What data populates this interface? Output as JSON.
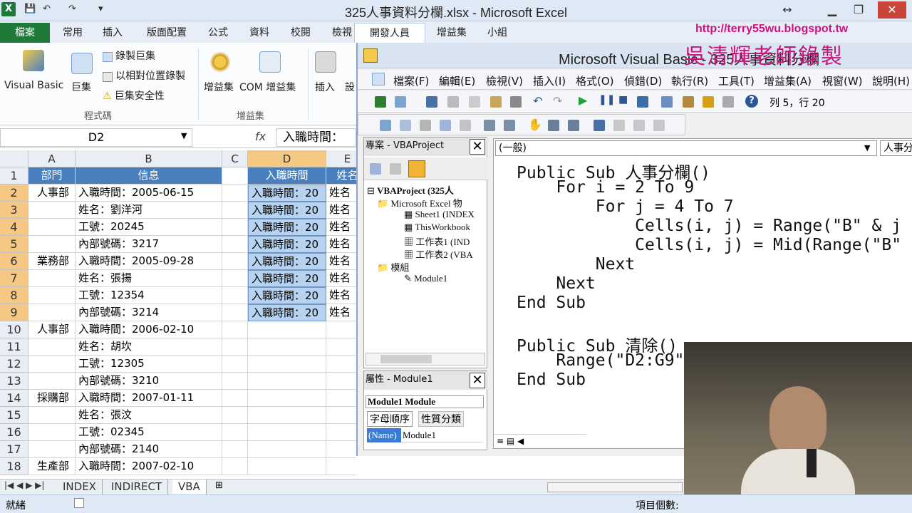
{
  "window": {
    "title": "325人事資料分欄.xlsx - Microsoft Excel",
    "qat": [
      "↶",
      "↷"
    ]
  },
  "ribbon": {
    "tabs": [
      "檔案",
      "常用",
      "插入",
      "版面配置",
      "公式",
      "資料",
      "校閱",
      "檢視",
      "開發人員",
      "增益集",
      "小組"
    ],
    "code_group": {
      "label": "程式碼",
      "visual_basic": "Visual Basic",
      "macros": "巨集",
      "record_macro": "錄製巨集",
      "relative_ref": "以相對位置錄製",
      "macro_security": "巨集安全性"
    },
    "addins_group": {
      "label": "增益集",
      "addins": "增益集",
      "com_addins": "COM 增益集"
    },
    "controls_group": {
      "insert": "插入",
      "design": "設"
    }
  },
  "formula_bar": {
    "name_box": "D2",
    "fx": "fx",
    "value": "入職時間："
  },
  "sheet": {
    "columns": [
      "A",
      "B",
      "C",
      "D",
      "E"
    ],
    "rows": [
      {
        "n": "1",
        "a": "部門",
        "b": "信息",
        "d": "入職時間",
        "e": "姓名"
      },
      {
        "n": "2",
        "a": "人事部",
        "b": "入職時間：2005-06-15",
        "d": "入職時間：20",
        "e": "姓名"
      },
      {
        "n": "3",
        "a": "",
        "b": "姓名：劉洋河",
        "d": "入職時間：20",
        "e": "姓名"
      },
      {
        "n": "4",
        "a": "",
        "b": "工號：20245",
        "d": "入職時間：20",
        "e": "姓名"
      },
      {
        "n": "5",
        "a": "",
        "b": "內部號碼：3217",
        "d": "入職時間：20",
        "e": "姓名"
      },
      {
        "n": "6",
        "a": "業務部",
        "b": "入職時間：2005-09-28",
        "d": "入職時間：20",
        "e": "姓名"
      },
      {
        "n": "7",
        "a": "",
        "b": "姓名：張揚",
        "d": "入職時間：20",
        "e": "姓名"
      },
      {
        "n": "8",
        "a": "",
        "b": "工號：12354",
        "d": "入職時間：20",
        "e": "姓名"
      },
      {
        "n": "9",
        "a": "",
        "b": "內部號碼：3214",
        "d": "入職時間：20",
        "e": "姓名"
      },
      {
        "n": "10",
        "a": "人事部",
        "b": "入職時間：2006-02-10",
        "d": "",
        "e": ""
      },
      {
        "n": "11",
        "a": "",
        "b": "姓名：胡坎",
        "d": "",
        "e": ""
      },
      {
        "n": "12",
        "a": "",
        "b": "工號：12305",
        "d": "",
        "e": ""
      },
      {
        "n": "13",
        "a": "",
        "b": "內部號碼：3210",
        "d": "",
        "e": ""
      },
      {
        "n": "14",
        "a": "採購部",
        "b": "入職時間：2007-01-11",
        "d": "",
        "e": ""
      },
      {
        "n": "15",
        "a": "",
        "b": "姓名：張汶",
        "d": "",
        "e": ""
      },
      {
        "n": "16",
        "a": "",
        "b": "工號：02345",
        "d": "",
        "e": ""
      },
      {
        "n": "17",
        "a": "",
        "b": "內部號碼：2140",
        "d": "",
        "e": ""
      },
      {
        "n": "18",
        "a": "生產部",
        "b": "入職時間：2007-02-10",
        "d": "",
        "e": ""
      }
    ],
    "sheet_tabs": [
      "INDEX",
      "INDIRECT",
      "VBA"
    ]
  },
  "status": {
    "left": "就緒",
    "right": "項目個數:"
  },
  "vbe": {
    "title": "Microsoft Visual Basic - 325人事資料分欄",
    "menu": [
      "檔案(F)",
      "編輯(E)",
      "檢視(V)",
      "插入(I)",
      "格式(O)",
      "偵錯(D)",
      "執行(R)",
      "工具(T)",
      "增益集(A)",
      "視窗(W)",
      "說明(H)"
    ],
    "cursor_pos": "列 5，行 20",
    "project_title": "專案 - VBAProject",
    "tree": [
      {
        "label": "VBAProject (325人",
        "bold": true
      },
      {
        "label": "Microsoft Excel 物"
      },
      {
        "label": "Sheet1 (INDEX"
      },
      {
        "label": "ThisWorkbook"
      },
      {
        "label": "工作表1 (IND"
      },
      {
        "label": "工作表2 (VBA"
      },
      {
        "label": "模組"
      },
      {
        "label": "Module1"
      }
    ],
    "props_title": "屬性 - Module1",
    "props_object": "Module1 Module",
    "props_tabs": [
      "字母順序",
      "性質分類"
    ],
    "props_row": {
      "name": "(Name)",
      "value": "Module1"
    },
    "combo_general": "(一般)",
    "combo_proc": "人事分",
    "code_lines": [
      "Public Sub 人事分欄()",
      "    For i = 2 To 9",
      "        For j = 4 To 7",
      "            Cells(i, j) = Range(\"B\" & j",
      "            Cells(i, j) = Mid(Range(\"B\"",
      "        Next",
      "    Next",
      "End Sub",
      "",
      "Public Sub 清除()",
      "    Range(\"D2:G9\"",
      "End Sub"
    ]
  },
  "overlay": {
    "url": "http://terry55wu.blogspot.tw",
    "watermark": "吳清輝老師錄製"
  },
  "colors": {
    "file_tab": "#1f7a3a",
    "header_cell": "#4a7fbf",
    "selection": "#b8d3f0",
    "watermark": "#c8157a"
  }
}
